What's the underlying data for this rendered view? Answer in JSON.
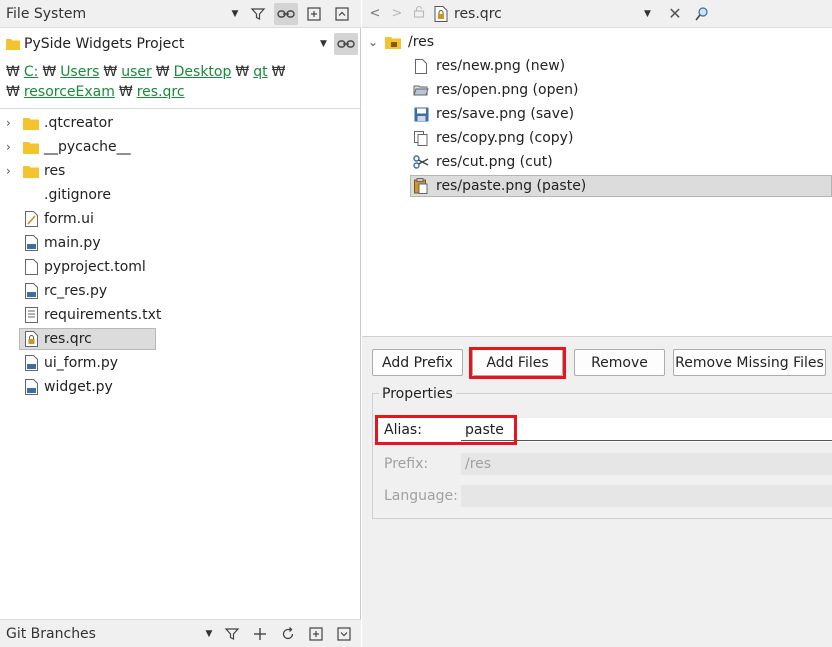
{
  "file_system": {
    "title": "File System",
    "project_selector": "PySide Widgets Project",
    "breadcrumb_sep": "₩",
    "breadcrumb": [
      "C:",
      "Users",
      "user",
      "Desktop",
      "qt",
      "resorceExam",
      "res.qrc"
    ],
    "tree": [
      {
        "label": ".qtcreator",
        "kind": "folder",
        "expandable": true
      },
      {
        "label": "__pycache__",
        "kind": "folder",
        "expandable": true
      },
      {
        "label": "res",
        "kind": "folder",
        "expandable": true
      },
      {
        "label": ".gitignore",
        "kind": "blank",
        "expandable": false
      },
      {
        "label": "form.ui",
        "kind": "ui",
        "expandable": false
      },
      {
        "label": "main.py",
        "kind": "py",
        "expandable": false
      },
      {
        "label": "pyproject.toml",
        "kind": "text",
        "expandable": false
      },
      {
        "label": "rc_res.py",
        "kind": "py",
        "expandable": false
      },
      {
        "label": "requirements.txt",
        "kind": "lines",
        "expandable": false
      },
      {
        "label": "res.qrc",
        "kind": "qrc",
        "expandable": false,
        "selected": true
      },
      {
        "label": "ui_form.py",
        "kind": "py",
        "expandable": false
      },
      {
        "label": "widget.py",
        "kind": "py",
        "expandable": false
      }
    ]
  },
  "git_branches": {
    "title": "Git Branches"
  },
  "editor": {
    "filename": "res.qrc",
    "prefix": "/res",
    "files": [
      {
        "label": "res/new.png (new)",
        "icon": "new-file-icon"
      },
      {
        "label": "res/open.png (open)",
        "icon": "open-icon"
      },
      {
        "label": "res/save.png (save)",
        "icon": "save-icon"
      },
      {
        "label": "res/copy.png (copy)",
        "icon": "copy-icon"
      },
      {
        "label": "res/cut.png (cut)",
        "icon": "cut-icon"
      },
      {
        "label": "res/paste.png (paste)",
        "icon": "paste-icon",
        "selected": true
      }
    ],
    "buttons": {
      "add_prefix": "Add Prefix",
      "add_files": "Add Files",
      "remove": "Remove",
      "remove_missing": "Remove Missing Files"
    },
    "properties": {
      "legend": "Properties",
      "alias_label": "Alias:",
      "alias_value": "paste",
      "prefix_label": "Prefix:",
      "prefix_value": "/res",
      "language_label": "Language:",
      "language_value": ""
    }
  },
  "colors": {
    "highlight": "#e8141e",
    "link": "#1a8a3a",
    "folder": "#f4c430"
  }
}
